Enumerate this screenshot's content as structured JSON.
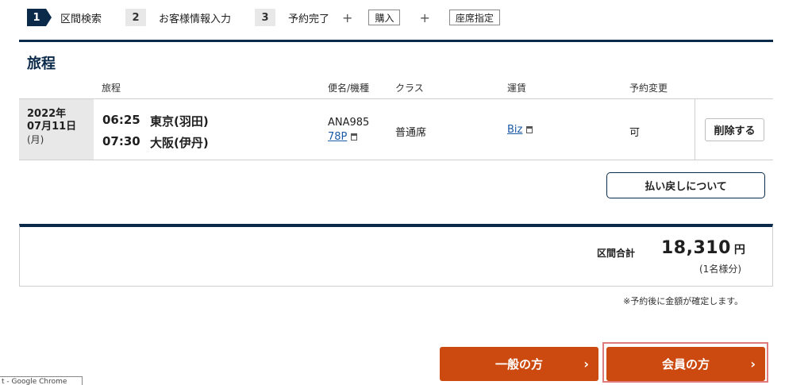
{
  "steps": {
    "s1": {
      "num": "1",
      "label": "区間検索"
    },
    "s2": {
      "num": "2",
      "label": "お客様情報入力"
    },
    "s3": {
      "num": "3",
      "label": "予約完了"
    },
    "plus": "+",
    "purchase": "購入",
    "seat": "座席指定"
  },
  "itinerary": {
    "title": "旅程",
    "headers": {
      "route": "旅程",
      "flight": "便名/機種",
      "class": "クラス",
      "fare": "運賃",
      "change": "予約変更"
    },
    "row": {
      "date_year": "2022年",
      "date_md": "07月11日",
      "date_dow": "(月)",
      "dep_time": "06:25",
      "dep_place": "東京(羽田)",
      "arr_time": "07:30",
      "arr_place": "大阪(伊丹)",
      "flight_no": "ANA985",
      "aircraft": "78P",
      "class": "普通席",
      "fare": "Biz",
      "change": "可",
      "delete_label": "削除する"
    },
    "refund_label": "払い戻しについて"
  },
  "total": {
    "label": "区間合計",
    "amount": "18,310",
    "unit": "円",
    "sub": "(1名様分)",
    "note": "※予約後に金額が確定します。"
  },
  "actions": {
    "general": "一般の方",
    "member": "会員の方",
    "chevron": "›"
  },
  "browser": {
    "tab_text": "t - Google Chrome"
  }
}
